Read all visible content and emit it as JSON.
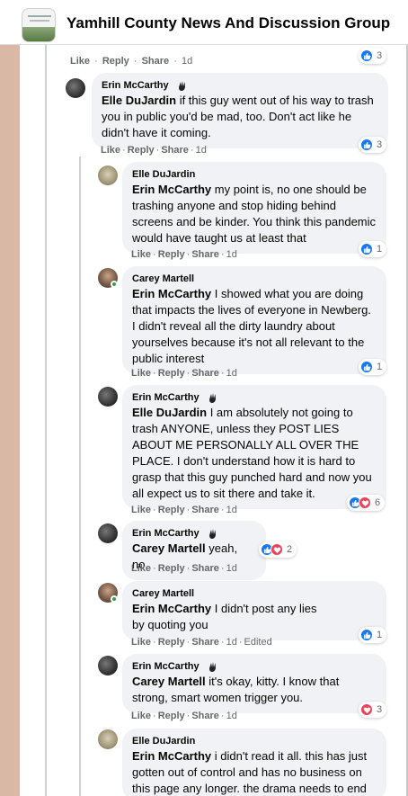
{
  "header": {
    "group_name": "Yamhill County News And Discussion Group"
  },
  "actions": {
    "like": "Like",
    "reply": "Reply",
    "share": "Share",
    "dot": "·"
  },
  "top_actions": {
    "time": "1d",
    "reaction_count": "3"
  },
  "comments": [
    {
      "author": "Erin McCarthy",
      "mention": "Elle DuJardin",
      "text": " if this guy went out of his way to trash you in public you'd be mad, too. Don't act like he didn't have it coming.",
      "time": "1d",
      "reaction_count": "3"
    },
    {
      "author": "Elle DuJardin",
      "mention": "Erin McCarthy",
      "text": " my point is, no one should be trashing anyone and stop hiding behind screens and be kinder. You think this pandemic would have taught us at least that",
      "time": "1d",
      "reaction_count": "1"
    },
    {
      "author": "Carey Martell",
      "mention": "Erin McCarthy",
      "text": " I showed what you are doing that impacts the lives of everyone in Newberg. I didn't reveal all the dirty laundry about yourselves because it's not all relevant to the public interest",
      "time": "1d",
      "reaction_count": "1"
    },
    {
      "author": "Erin McCarthy",
      "mention": "Elle DuJardin",
      "text": " I am absolutely not going to trash ANYONE, unless they POST LIES ABOUT ME PERSONALLY ALL OVER THE PLACE. I don't understand how it is hard to grasp that this guy punched hard and now you all expect us to sit there and take it.",
      "time": "1d",
      "reaction_count": "6"
    },
    {
      "author": "Erin McCarthy",
      "mention": "Carey Martell",
      "text": " yeah, no.",
      "time": "1d",
      "reaction_count": "2"
    },
    {
      "author": "Carey Martell",
      "mention": "Erin McCarthy",
      "text": " I didn't post any lies by quoting you",
      "time": "1d",
      "edited": "Edited",
      "reaction_count": "1"
    },
    {
      "author": "Erin McCarthy",
      "mention": "Carey Martell",
      "text": " it's okay, kitty. I know that strong, smart women trigger you.",
      "time": "1d",
      "reaction_count": "3"
    },
    {
      "author": "Elle DuJardin",
      "mention": "Erin McCarthy",
      "text": " i didn't read it all. this has just gotten out of control and has no business on this page any longer. the drama needs to end",
      "time": "",
      "reaction_count": ""
    }
  ],
  "colors": {
    "like_blue": "#1877f2",
    "love_red": "#f33e58",
    "bubble_gray": "#f0f2f5",
    "meta_gray": "#65676b"
  },
  "icons": {
    "like": "thumbs-up-icon",
    "love": "heart-icon",
    "badge": "waving-hand-icon"
  }
}
